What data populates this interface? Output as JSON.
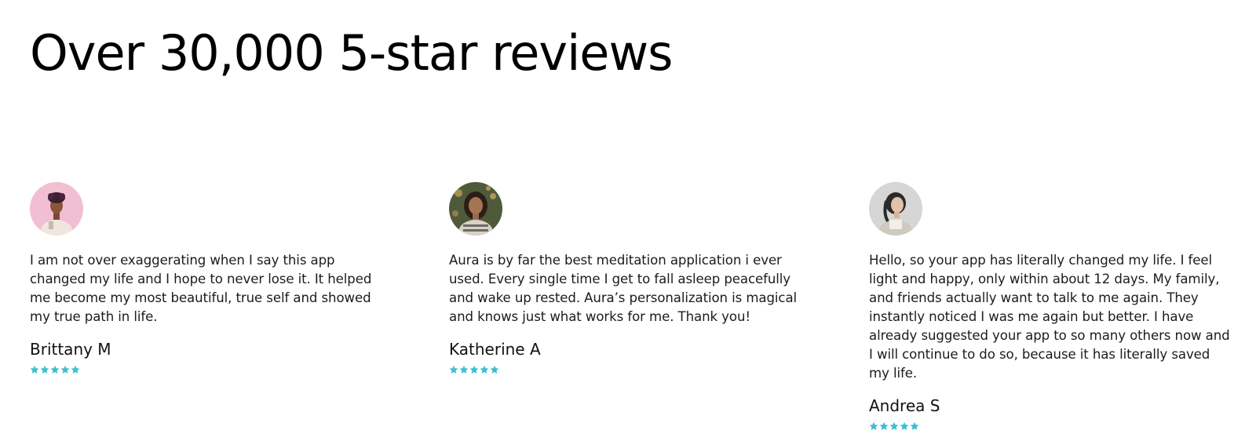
{
  "header": {
    "title": "Over 30,000 5-star reviews"
  },
  "colors": {
    "star": "#3dbfcf",
    "text": "#1c1c1c",
    "title": "#000000"
  },
  "reviews": [
    {
      "avatar_icon": "avatar-photo",
      "text": "I am not over exaggerating when I say this app changed my life and I hope to never lose it. It helped me become my most beautiful, true self and showed my true path in life.",
      "name": "Brittany M",
      "rating": 5
    },
    {
      "avatar_icon": "avatar-photo",
      "text": "Aura is by far the best meditation application i ever used. Every single time I get to fall asleep peacefully and wake up rested. Aura’s personalization is magical and knows just what works for me. Thank you!",
      "name": "Katherine A",
      "rating": 5
    },
    {
      "avatar_icon": "avatar-photo",
      "text": "Hello, so your app has literally changed my life. I feel light and happy, only within about 12 days. My family, and friends actually want to talk to me again. They instantly noticed I was me again but better. I have already suggested your app to so many others now and I will continue to do so, because it has literally saved my life.",
      "name": "Andrea S",
      "rating": 5
    }
  ]
}
